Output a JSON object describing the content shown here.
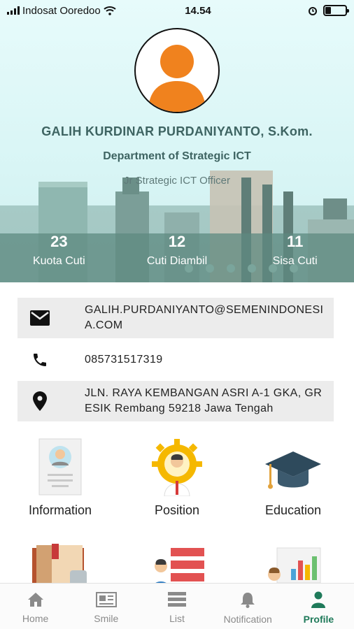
{
  "status_bar": {
    "carrier": "Indosat Ooredoo",
    "time": "14.54"
  },
  "profile": {
    "name": "GALIH KURDINAR PURDANIYANTO, S.Kom.",
    "department": "Department of Strategic ICT",
    "position": "Jr Strategic ICT Officer"
  },
  "stats": [
    {
      "value": "23",
      "label": "Kuota Cuti"
    },
    {
      "value": "12",
      "label": "Cuti Diambil"
    },
    {
      "value": "11",
      "label": "Sisa Cuti"
    }
  ],
  "contacts": {
    "email": {
      "icon": "mail-icon",
      "value": "GALIH.PURDANIYANTO@SEMENINDONESIA.COM"
    },
    "phone": {
      "icon": "phone-icon",
      "value": "085731517319"
    },
    "address": {
      "icon": "location-pin-icon",
      "value": "JLN. RAYA KEMBANGAN ASRI A-1 GKA, GRESIK Rembang 59218 Jawa Tengah"
    }
  },
  "menu": [
    {
      "label": "Information",
      "icon": "information-card-icon"
    },
    {
      "label": "Position",
      "icon": "position-gear-icon"
    },
    {
      "label": "Education",
      "icon": "graduation-cap-icon"
    },
    {
      "label": "",
      "icon": "book-icon"
    },
    {
      "label": "",
      "icon": "career-list-icon"
    },
    {
      "label": "",
      "icon": "performance-chart-icon"
    }
  ],
  "bottom_nav": [
    {
      "label": "Home",
      "icon": "home-icon"
    },
    {
      "label": "Smile",
      "icon": "newspaper-icon"
    },
    {
      "label": "List",
      "icon": "list-icon"
    },
    {
      "label": "Notification",
      "icon": "bell-icon"
    },
    {
      "label": "Profile",
      "icon": "person-icon",
      "active": true
    }
  ],
  "colors": {
    "header_bg": "#d8f5f5",
    "heading_text": "#3e6462",
    "accent_green": "#1f7a5a",
    "avatar_orange": "#f0821e"
  }
}
